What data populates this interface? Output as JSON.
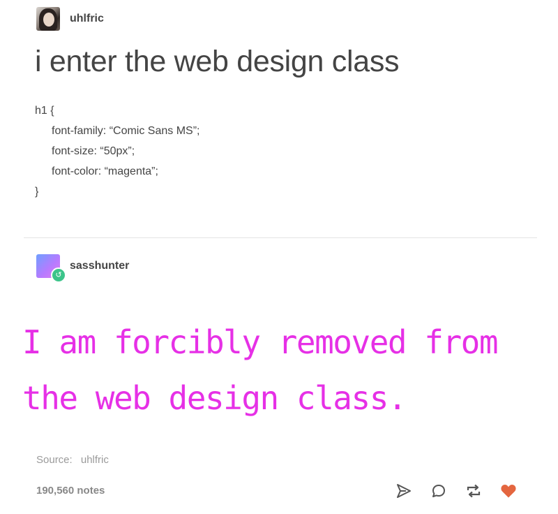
{
  "post": {
    "author": "uhlfric",
    "heading": "i enter the web design class",
    "code": {
      "open": "h1 {",
      "lines": [
        "font-family: “Comic Sans MS”;",
        "font-size: “50px”;",
        "font-color: “magenta”;"
      ],
      "close": "}"
    }
  },
  "reply": {
    "author": "sasshunter",
    "text": "I am forcibly removed from the web design class."
  },
  "footer": {
    "source_label": "Source:",
    "source_user": "uhlfric",
    "notes": "190,560 notes"
  },
  "colors": {
    "reply_text": "#e630e6",
    "like": "#e4663f",
    "reblog_badge": "#3cc48a"
  },
  "icons": [
    "share-icon",
    "reply-icon",
    "reblog-icon",
    "like-icon"
  ]
}
